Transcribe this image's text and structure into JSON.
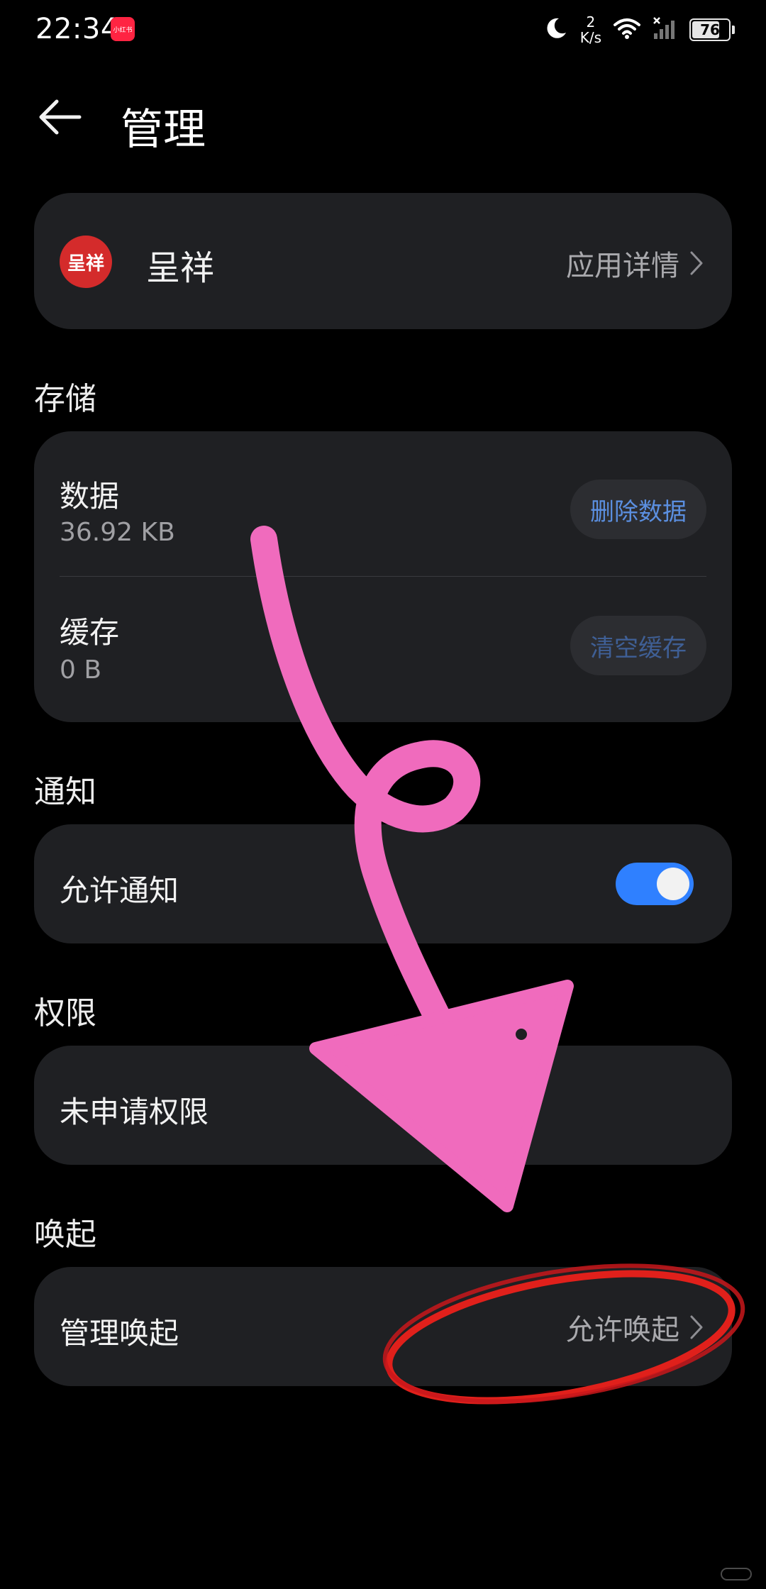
{
  "status_bar": {
    "time": "22:34",
    "notif_app_label": "小红书",
    "net_speed_value": "2",
    "net_speed_unit": "K/s",
    "battery": "76"
  },
  "header": {
    "title": "管理"
  },
  "app": {
    "icon_text": "呈祥",
    "name": "呈祥",
    "detail_label": "应用详情"
  },
  "storage": {
    "section_title": "存储",
    "data_label": "数据",
    "data_size": "36.92 KB",
    "delete_button": "删除数据",
    "cache_label": "缓存",
    "cache_size": "0 B",
    "clear_button": "清空缓存"
  },
  "notifications": {
    "section_title": "通知",
    "allow_label": "允许通知",
    "allow_enabled": true
  },
  "permissions": {
    "section_title": "权限",
    "none_label": "未申请权限"
  },
  "wakeup": {
    "section_title": "唤起",
    "manage_label": "管理唤起",
    "value": "允许唤起"
  },
  "colors": {
    "accent": "#2f80ff",
    "button_text": "#5b8fe0",
    "button_text_disabled": "#3f5f95",
    "card_bg": "#1f2023",
    "annotation_pink": "#f06bbd",
    "annotation_red": "#e0201b"
  }
}
